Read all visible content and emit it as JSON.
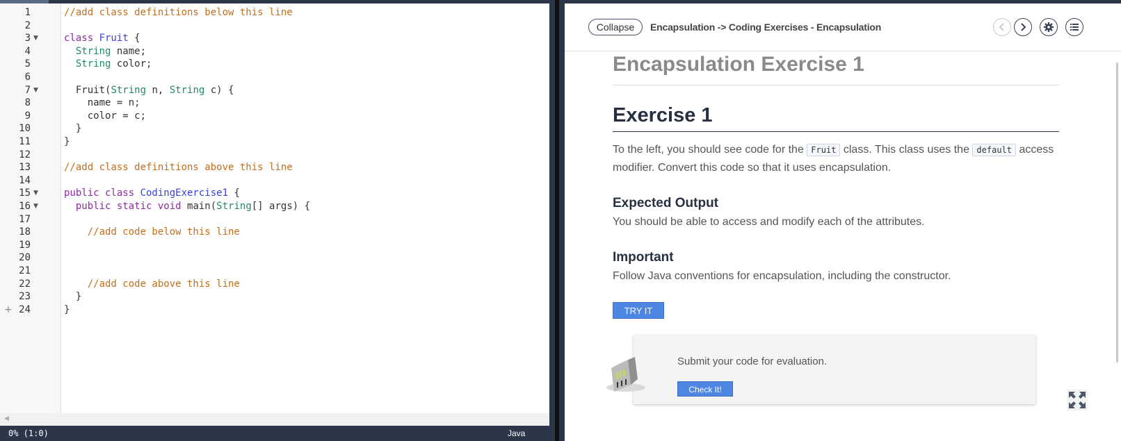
{
  "editor": {
    "lines": [
      {
        "no": "1",
        "fold": false,
        "tokens": [
          {
            "t": "//add class definitions below this line",
            "c": "comment"
          }
        ]
      },
      {
        "no": "2",
        "fold": false,
        "tokens": []
      },
      {
        "no": "3",
        "fold": true,
        "tokens": [
          {
            "t": "class ",
            "c": "kw"
          },
          {
            "t": "Fruit",
            "c": "cls"
          },
          {
            "t": " {",
            "c": "plain"
          }
        ]
      },
      {
        "no": "4",
        "fold": false,
        "tokens": [
          {
            "t": "  ",
            "c": "plain"
          },
          {
            "t": "String",
            "c": "type"
          },
          {
            "t": " name;",
            "c": "plain"
          }
        ]
      },
      {
        "no": "5",
        "fold": false,
        "tokens": [
          {
            "t": "  ",
            "c": "plain"
          },
          {
            "t": "String",
            "c": "type"
          },
          {
            "t": " color;",
            "c": "plain"
          }
        ]
      },
      {
        "no": "6",
        "fold": false,
        "tokens": []
      },
      {
        "no": "7",
        "fold": true,
        "tokens": [
          {
            "t": "  Fruit(",
            "c": "plain"
          },
          {
            "t": "String",
            "c": "type"
          },
          {
            "t": " n, ",
            "c": "plain"
          },
          {
            "t": "String",
            "c": "type"
          },
          {
            "t": " c) {",
            "c": "plain"
          }
        ]
      },
      {
        "no": "8",
        "fold": false,
        "tokens": [
          {
            "t": "    name = n;",
            "c": "plain"
          }
        ]
      },
      {
        "no": "9",
        "fold": false,
        "tokens": [
          {
            "t": "    color = c;",
            "c": "plain"
          }
        ]
      },
      {
        "no": "10",
        "fold": false,
        "tokens": [
          {
            "t": "  }",
            "c": "plain"
          }
        ]
      },
      {
        "no": "11",
        "fold": false,
        "tokens": [
          {
            "t": "}",
            "c": "plain"
          }
        ]
      },
      {
        "no": "12",
        "fold": false,
        "tokens": []
      },
      {
        "no": "13",
        "fold": false,
        "tokens": [
          {
            "t": "//add class definitions above this line",
            "c": "comment"
          }
        ]
      },
      {
        "no": "14",
        "fold": false,
        "tokens": []
      },
      {
        "no": "15",
        "fold": true,
        "tokens": [
          {
            "t": "public class ",
            "c": "kw"
          },
          {
            "t": "CodingExercise1",
            "c": "cls"
          },
          {
            "t": " {",
            "c": "plain"
          }
        ]
      },
      {
        "no": "16",
        "fold": true,
        "tokens": [
          {
            "t": "  public static void ",
            "c": "kw"
          },
          {
            "t": "main(",
            "c": "plain"
          },
          {
            "t": "String",
            "c": "type"
          },
          {
            "t": "[] args) {",
            "c": "plain"
          }
        ]
      },
      {
        "no": "17",
        "fold": false,
        "tokens": []
      },
      {
        "no": "18",
        "fold": false,
        "tokens": [
          {
            "t": "    ",
            "c": "plain"
          },
          {
            "t": "//add code below this line",
            "c": "comment"
          }
        ]
      },
      {
        "no": "19",
        "fold": false,
        "tokens": []
      },
      {
        "no": "20",
        "fold": false,
        "tokens": []
      },
      {
        "no": "21",
        "fold": false,
        "tokens": []
      },
      {
        "no": "22",
        "fold": false,
        "tokens": [
          {
            "t": "    ",
            "c": "plain"
          },
          {
            "t": "//add code above this line",
            "c": "comment"
          }
        ]
      },
      {
        "no": "23",
        "fold": false,
        "tokens": [
          {
            "t": "  }",
            "c": "plain"
          }
        ]
      },
      {
        "no": "24",
        "fold": false,
        "plus": true,
        "tokens": [
          {
            "t": "}",
            "c": "plain"
          }
        ]
      }
    ],
    "status_position": "0% (1:0)",
    "status_language": "Java"
  },
  "guide": {
    "collapse_label": "Collapse",
    "title": "Encapsulation -> Coding Exercises - Encapsulation",
    "page_heading": "Encapsulation Exercise 1",
    "exercise_heading": "Exercise 1",
    "intro_1": "To the left, you should see code for the ",
    "intro_code_1": "Fruit",
    "intro_2": " class. This class uses the ",
    "intro_code_2": "default",
    "intro_3": " access modifier. Convert this code so that it uses encapsulation.",
    "expected_heading": "Expected Output",
    "expected_text": "You should be able to access and modify each of the attributes.",
    "important_heading": "Important",
    "important_text": "Follow Java conventions for encapsulation, including the constructor.",
    "try_label": "TRY IT",
    "eval_text": "Submit your code for evaluation.",
    "check_label": "Check It!"
  },
  "colors": {
    "comment": "#c36e1b",
    "keyword": "#8e2ba3",
    "class_name": "#3a3fe0",
    "type": "#1d8a6a",
    "button": "#4e86e3",
    "chrome": "#2b3648"
  }
}
